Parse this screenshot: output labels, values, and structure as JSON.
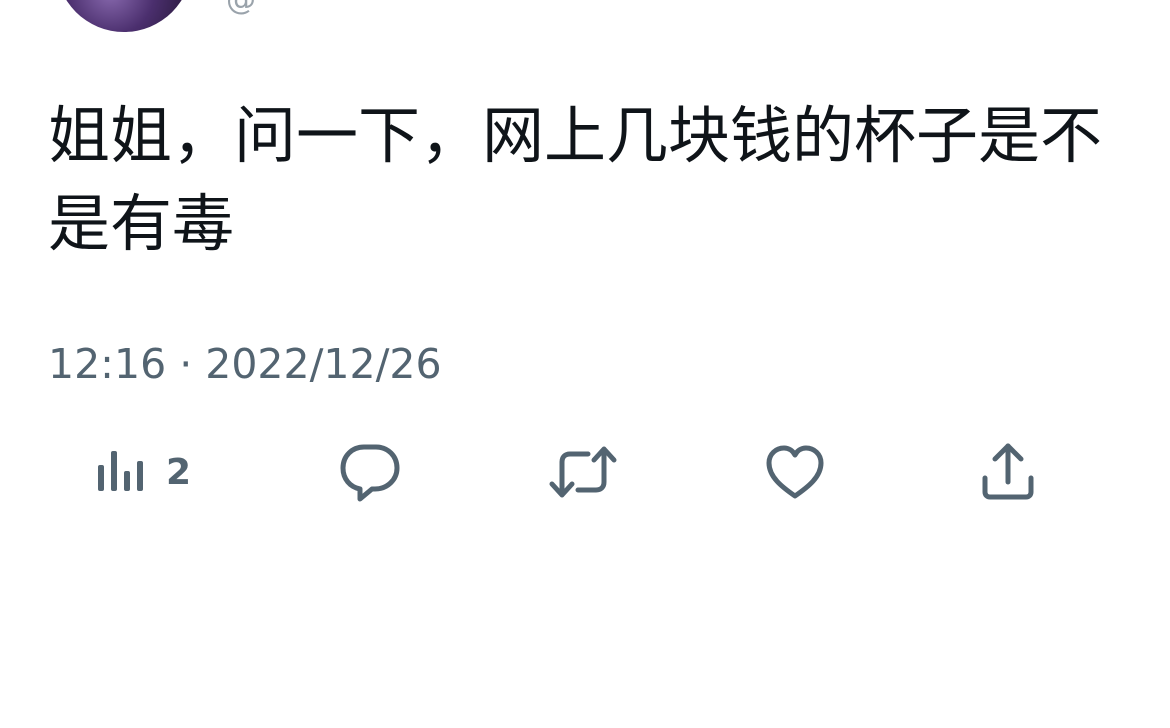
{
  "tweet": {
    "handle_fragment": "@",
    "text": "姐姐，问一下，网上几块钱的杯子是不是有毒",
    "timestamp": "12:16 · 2022/12/26"
  },
  "actions": {
    "views": {
      "icon": "bar-chart-icon",
      "count": "2"
    },
    "reply": {
      "icon": "speech-bubble-icon"
    },
    "retweet": {
      "icon": "retweet-arrows-icon"
    },
    "like": {
      "icon": "heart-icon"
    },
    "share": {
      "icon": "share-upload-icon"
    }
  },
  "colors": {
    "text": "#0f1419",
    "secondary": "#536471",
    "background": "#ffffff"
  }
}
